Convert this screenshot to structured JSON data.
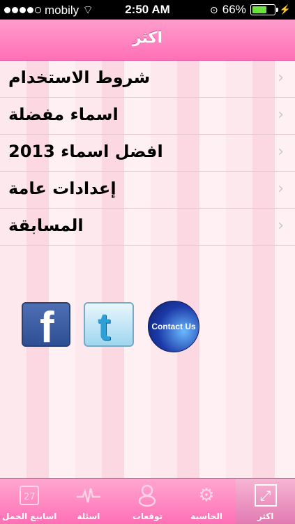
{
  "status_bar": {
    "carrier": "mobily",
    "time": "2:50 AM",
    "battery": "66%"
  },
  "nav": {
    "title": "اكثر"
  },
  "menu": {
    "items": [
      {
        "label": "شروط الاستخدام"
      },
      {
        "label": "اسماء مفضلة"
      },
      {
        "label": "افضل اسماء 2013"
      },
      {
        "label": "إعدادات عامة"
      },
      {
        "label": "المسابقة"
      }
    ]
  },
  "social": {
    "contact_label": "Contact Us"
  },
  "tabs": [
    {
      "label": "اسابيع الحمل",
      "icon": "calendar-icon",
      "day": "27"
    },
    {
      "label": "اسئلة",
      "icon": "heartbeat-icon"
    },
    {
      "label": "توقعات",
      "icon": "baby-icon"
    },
    {
      "label": "الحاسبة",
      "icon": "gear-icon"
    },
    {
      "label": "اكثر",
      "icon": "expand-icon",
      "active": true
    }
  ],
  "colors": {
    "accent": "#ff6fb5",
    "tab_icon": "#ffd3e8"
  }
}
